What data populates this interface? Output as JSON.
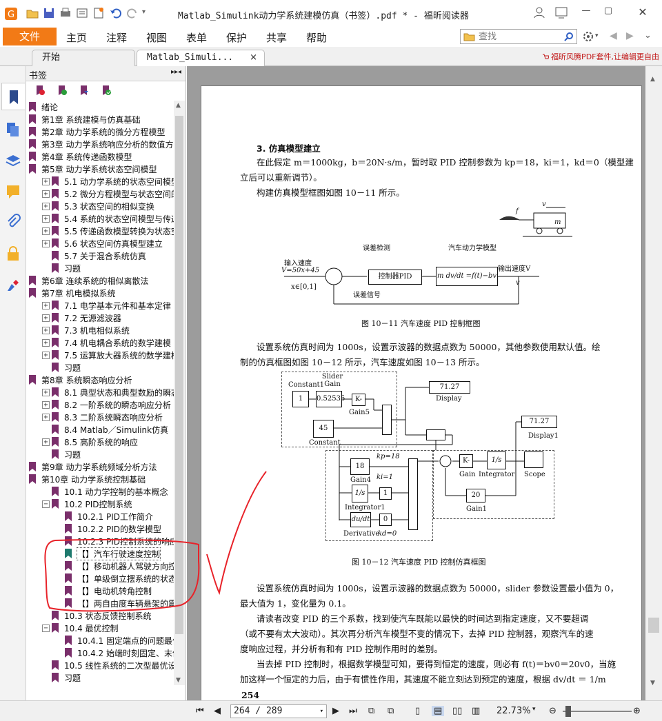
{
  "window": {
    "title": "Matlab_Simulink动力学系统建模仿真（书签）.pdf * - 福昕阅读器"
  },
  "menu": {
    "file": "文件",
    "items": [
      "主页",
      "注释",
      "视图",
      "表单",
      "保护",
      "共享",
      "帮助"
    ]
  },
  "search": {
    "placeholder": "查找"
  },
  "tabs": [
    {
      "label": "开始"
    },
    {
      "label": "Matlab_Simuli...",
      "close": "×"
    }
  ],
  "promo": "福昕风腾PDF套件,让编辑更自由",
  "bookmarks": {
    "title": "书签",
    "collapse_glyph": "▸▸◂",
    "items": [
      {
        "label": "绪论",
        "level": 0,
        "expander": "",
        "selected": false
      },
      {
        "label": "第1章 系统建模与仿真基础",
        "level": 0,
        "expander": ""
      },
      {
        "label": "第2章 动力学系统的微分方程模型",
        "level": 0,
        "expander": ""
      },
      {
        "label": "第3章 动力学系统响应分析的数值方",
        "level": 0,
        "expander": ""
      },
      {
        "label": "第4章 系统传递函数模型",
        "level": 0,
        "expander": ""
      },
      {
        "label": "第5章 动力学系统状态空间模型",
        "level": 0,
        "expander": ""
      },
      {
        "label": "5.1 动力学系统的状态空间模型",
        "level": 1,
        "expander": "+"
      },
      {
        "label": "5.2 微分方程模型与状态空间的关",
        "level": 1,
        "expander": "+"
      },
      {
        "label": "5.3 状态空间的相似变换",
        "level": 1,
        "expander": "+"
      },
      {
        "label": "5.4 系统的状态空间模型与传递函",
        "level": 1,
        "expander": "+"
      },
      {
        "label": "5.5 传递函数模型转换为状态空间",
        "level": 1,
        "expander": "+"
      },
      {
        "label": "5.6 状态空间仿真模型建立",
        "level": 1,
        "expander": "+"
      },
      {
        "label": "5.7 关于混合系统仿真",
        "level": 1,
        "expander": ""
      },
      {
        "label": "习题",
        "level": 1,
        "expander": ""
      },
      {
        "label": "第6章 连续系统的相似离散法",
        "level": 0,
        "expander": ""
      },
      {
        "label": "第7章 机电模拟系统",
        "level": 0,
        "expander": ""
      },
      {
        "label": "7.1 电学基本元件和基本定律",
        "level": 1,
        "expander": "+"
      },
      {
        "label": "7.2 无源滤波器",
        "level": 1,
        "expander": "+"
      },
      {
        "label": "7.3 机电相似系统",
        "level": 1,
        "expander": "+"
      },
      {
        "label": "7.4 机电耦合系统的数学建模",
        "level": 1,
        "expander": "+"
      },
      {
        "label": "7.5 运算放大器系统的数学建模",
        "level": 1,
        "expander": "+"
      },
      {
        "label": "习题",
        "level": 1,
        "expander": ""
      },
      {
        "label": "第8章 系统瞬态响应分析",
        "level": 0,
        "expander": ""
      },
      {
        "label": "8.1 典型状态和典型数励的瞬态响",
        "level": 1,
        "expander": "+"
      },
      {
        "label": "8.2 一阶系统的瞬态响应分析",
        "level": 1,
        "expander": "+"
      },
      {
        "label": "8.3 二阶系统瞬态响应分析",
        "level": 1,
        "expander": "+"
      },
      {
        "label": "8.4 Matlab／Simulink仿真",
        "level": 1,
        "expander": ""
      },
      {
        "label": "8.5 高阶系统的响应",
        "level": 1,
        "expander": "+"
      },
      {
        "label": "习题",
        "level": 1,
        "expander": ""
      },
      {
        "label": "第9章 动力学系统频域分析方法",
        "level": 0,
        "expander": ""
      },
      {
        "label": "第10章 动力学系统控制基础",
        "level": 0,
        "expander": ""
      },
      {
        "label": "10.1 动力学控制的基本概念",
        "level": 1,
        "expander": ""
      },
      {
        "label": "10.2 PID控制系统",
        "level": 1,
        "expander": "−"
      },
      {
        "label": "10.2.1 PID工作简介",
        "level": 2,
        "expander": ""
      },
      {
        "label": "10.2.2 PID的数学模型",
        "level": 2,
        "expander": ""
      },
      {
        "label": "10.2.3 PID控制系统的响应分",
        "level": 2,
        "expander": ""
      },
      {
        "label": "【】汽车行驶速度控制",
        "level": 2,
        "expander": "",
        "selected": true
      },
      {
        "label": "【】移动机器人驾驶方向控制",
        "level": 2,
        "expander": ""
      },
      {
        "label": "【】单级倒立摆系统的状态反",
        "level": 2,
        "expander": ""
      },
      {
        "label": "【】电动机转角控制",
        "level": 2,
        "expander": ""
      },
      {
        "label": "【】两自由度车辆悬架的震动",
        "level": 2,
        "expander": ""
      },
      {
        "label": "10.3 状态反馈控制系统",
        "level": 1,
        "expander": ""
      },
      {
        "label": "10.4 最优控制",
        "level": 1,
        "expander": "−"
      },
      {
        "label": "10.4.1 固定端点的问题最优",
        "level": 2,
        "expander": ""
      },
      {
        "label": "10.4.2 始端时刻固定、末值",
        "level": 2,
        "expander": ""
      },
      {
        "label": "10.5 线性系统的二次型最优设计",
        "level": 1,
        "expander": ""
      },
      {
        "label": "习题",
        "level": 1,
        "expander": ""
      }
    ]
  },
  "document": {
    "heading": "3.  仿真模型建立",
    "para1_line1": "在此假定 m＝1000kg，b＝20N·s/m，暂时取 PID 控制参数为 kp＝18，ki＝1，kd＝0（模型建",
    "para1_line2": "立后可以重新调节）。",
    "para2": "构建仿真模型框图如图 10－11 所示。",
    "fig1": {
      "force_label": "f",
      "velocity_label": "v",
      "mass_label": "m",
      "error_detect": "误差检测",
      "vehicle_model": "汽车动力学模型",
      "input_label": "输入速度",
      "input_eq": "V=50x+45",
      "x_range": "x∈[0,1]",
      "controller": "控制器PID",
      "plant": "m dv/dt =f(t)−bv",
      "output_label": "输出速度V",
      "output_v": "v",
      "error_signal": "误差信号",
      "caption": "图 10－11    汽车速度 PID 控制框图"
    },
    "para3_line1": "设置系统仿真时间为 1000s，设置示波器的数据点数为 50000，其他参数使用默认值。绘",
    "para3_line2": "制的仿真框图如图 10－12 所示，汽车速度如图 10－13 所示。",
    "fig2": {
      "constant1": "Constant1",
      "slider_gain_label": "Slider Gain",
      "const1_value": "1",
      "slider_value": "0.52535",
      "gain5_block": "K-",
      "gain5_label": "Gain5",
      "constant_value": "45",
      "constant_label": "Constant",
      "display_value": "71.27",
      "display_label": "Display",
      "display1_value": "71.27",
      "display1_label": "Display1",
      "gain4_value": "18",
      "gain4_label": "Gain4",
      "kp_label": "kp=18",
      "ki_label": "ki=1",
      "kd_label": "kd=0",
      "integrator1_block": "1/s",
      "integrator1_label": "Integrator1",
      "ki_gain": "1",
      "derivative_block": "du/dt",
      "derivative_label": "Derivative",
      "kd_gain": "0",
      "gain_block": "K-",
      "gain_label": "Gain",
      "integrator_block": "1/s",
      "integrator_label": "Integrator",
      "scope_label": "Scope",
      "gain1_value": "20",
      "gain1_label": "Gain1",
      "caption": "图 10－12    汽车速度 PID 控制仿真框图"
    },
    "para4_line1": "设置系统仿真时间为 1000s，设置示波器的数据点数为 50000，slider 参数设置最小值为 0，",
    "para4_line2": "最大值为 1，变化量为 0.1。",
    "para5_line1": "请读者改变 PID 的三个系数，找到使汽车既能以最快的时间达到指定速度，又不要超调",
    "para5_line2": "（或不要有太大波动）。其次再分析汽车模型不变的情况下，去掉 PID 控制器，观察汽车的速",
    "para5_line3": "度响应过程，并分析有和有 PID 控制作用时的差别。",
    "para6_line1": "当去掉 PID 控制时，根据数学模型可知，要得到恒定的速度，则必有 f(t)＝bv0＝20v0，当施",
    "para6_line2": "加这样一个恒定的力后，由于有惯性作用，其速度不能立刻达到预定的速度，根据 dv/dt ＝ 1/m",
    "page_number": "254"
  },
  "status": {
    "page_display": "264 / 289",
    "zoom": "22.73%"
  },
  "colors": {
    "accent": "#f27a16",
    "bookmark_flag": "#7a2f6b",
    "bookmark_flag_selected": "#1f7a6e",
    "annotation": "#e8232a"
  }
}
